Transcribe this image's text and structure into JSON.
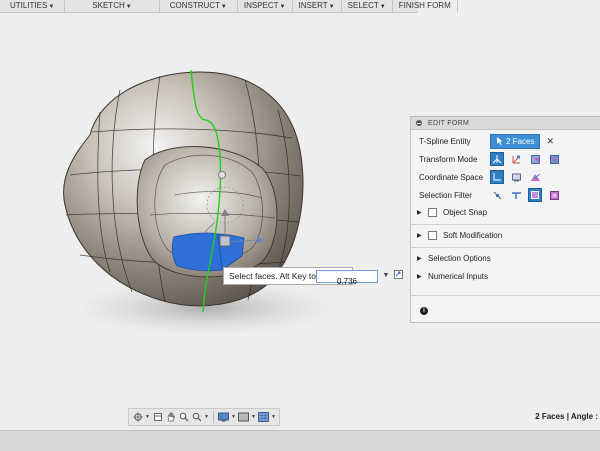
{
  "toolbar": {
    "items": [
      {
        "label": "UTILITIES",
        "has_menu": true
      },
      {
        "label": "SKETCH",
        "has_menu": true
      },
      {
        "label": "CONSTRUCT",
        "has_menu": true
      },
      {
        "label": "INSPECT",
        "has_menu": true
      },
      {
        "label": "INSERT",
        "has_menu": true
      },
      {
        "label": "SELECT",
        "has_menu": true
      },
      {
        "label": "FINISH FORM",
        "has_menu": false
      }
    ],
    "caret": "▼"
  },
  "viewport": {
    "tooltip": "Select faces. Alt Key to extrude",
    "value_input": "0.736"
  },
  "edit_form": {
    "title": "EDIT FORM",
    "entity_label": "T-Spline Entity",
    "entity_value": "2 Faces",
    "transform_label": "Transform Mode",
    "coordinate_label": "Coordinate Space",
    "filter_label": "Selection Filter",
    "object_snap": "Object Snap",
    "soft_modification": "Soft Modification",
    "selection_options": "Selection Options",
    "numerical_inputs": "Numerical Inputs"
  },
  "status": {
    "text": "2 Faces | Angle :"
  },
  "colors": {
    "accent": "#3c8fd6",
    "selected_face": "#2f6fd6",
    "symmetry_line": "#1fd11f"
  }
}
